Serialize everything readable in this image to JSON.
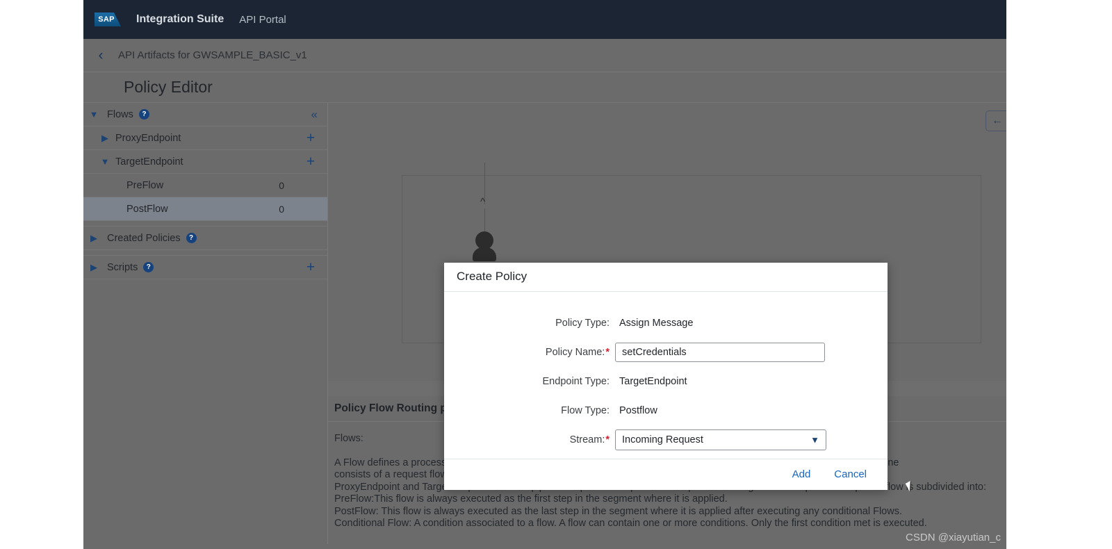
{
  "shell": {
    "logo_text": "SAP",
    "product": "Integration Suite",
    "section": "API Portal"
  },
  "breadcrumb": {
    "back_icon": "chevron-left-icon",
    "label": "API Artifacts for GWSAMPLE_BASIC_v1"
  },
  "page": {
    "title": "Policy Editor"
  },
  "sidebar": {
    "flows": {
      "label": "Flows",
      "expanded": true,
      "collapse_icon": "collapse-panel-icon",
      "children": [
        {
          "label": "ProxyEndpoint",
          "expanded": false,
          "add_label": "+"
        },
        {
          "label": "TargetEndpoint",
          "expanded": true,
          "add_label": "+"
        }
      ],
      "leaves": [
        {
          "label": "PreFlow",
          "count": "0",
          "selected": false
        },
        {
          "label": "PostFlow",
          "count": "0",
          "selected": true
        }
      ]
    },
    "created_policies": {
      "label": "Created Policies",
      "expanded": false
    },
    "scripts": {
      "label": "Scripts",
      "expanded": false,
      "add_label": "+"
    },
    "help_glyph": "?"
  },
  "canvas": {
    "zoom_reset_icon": "arrow-left-icon",
    "client_icon": "person-icon",
    "server_icon": "laptop-icon"
  },
  "info": {
    "heading": "Policy Flow Routing properties",
    "lines": [
      "Flows:",
      "",
      "A Flow defines a processing pipeline. Each flow consists of a request flow and a response flow. A message processing pipeline",
      "consists of a request flow and a response flow.",
      "ProxyEndpoint and TargetEndpoint define a pipeline to process request and response messages.Each request or response flow is subdivided into:",
      "PreFlow:This flow is always executed as the first step in the segment where it is applied.",
      "PostFlow: This flow is always executed as the last step in the segment where it is applied after executing any conditional Flows.",
      "Conditional Flow: A condition associated to a flow. A flow can contain one or more conditions. Only the first condition met is executed."
    ]
  },
  "dialog": {
    "title": "Create Policy",
    "fields": {
      "policy_type": {
        "label": "Policy Type:",
        "value": "Assign Message"
      },
      "policy_name": {
        "label": "Policy Name:",
        "value": "setCredentials",
        "required": "*"
      },
      "endpoint_type": {
        "label": "Endpoint Type:",
        "value": "TargetEndpoint"
      },
      "flow_type": {
        "label": "Flow Type:",
        "value": "Postflow"
      },
      "stream": {
        "label": "Stream:",
        "value": "Incoming Request",
        "required": "*",
        "caret_icon": "chevron-down-icon"
      }
    },
    "add_label": "Add",
    "cancel_label": "Cancel"
  },
  "watermark": "CSDN @xiayutian_c",
  "colors": {
    "shell_bg": "#1b2533",
    "page_bg": "#6b6b6b",
    "accent_blue": "#16437e",
    "link_blue": "#1665c0",
    "required_red": "#d32030"
  }
}
